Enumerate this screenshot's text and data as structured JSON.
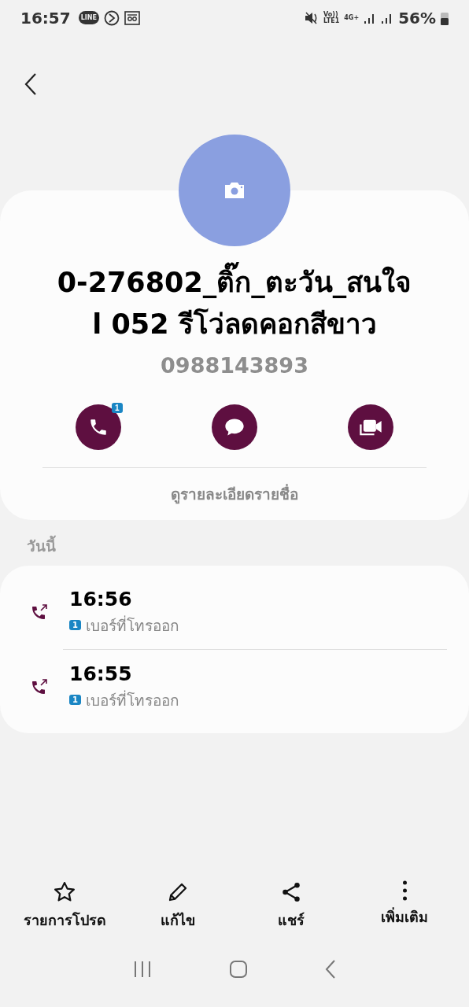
{
  "status_bar": {
    "time": "16:57",
    "line_badge": "LINE",
    "volte": "Vo))",
    "lte": "LTE1",
    "network": "4G+",
    "battery": "56%"
  },
  "contact": {
    "name_lines": [
      "0-276802_ติ๊ก_ตะวัน_สนใจ",
      "l 052 รีโว่ลดคอกสีขาว"
    ],
    "phone": "0988143893",
    "actions": [
      {
        "kind": "call",
        "badge": "1"
      },
      {
        "kind": "message"
      },
      {
        "kind": "video"
      }
    ],
    "details_link": "ดูรายละเอียดรายชื่อ"
  },
  "history": {
    "heading": "วันนี้",
    "calls": [
      {
        "kind": "outgoing",
        "time": "16:56",
        "sim": "1",
        "label": "เบอร์ที่โทรออก"
      },
      {
        "kind": "outgoing",
        "time": "16:55",
        "sim": "1",
        "label": "เบอร์ที่โทรออก"
      }
    ]
  },
  "bottom_bar": [
    {
      "kind": "favorite",
      "label": "รายการโปรด"
    },
    {
      "kind": "edit",
      "label": "แก้ไข"
    },
    {
      "kind": "share",
      "label": "แชร์"
    },
    {
      "kind": "more",
      "label": "เพิ่มเติม"
    }
  ]
}
